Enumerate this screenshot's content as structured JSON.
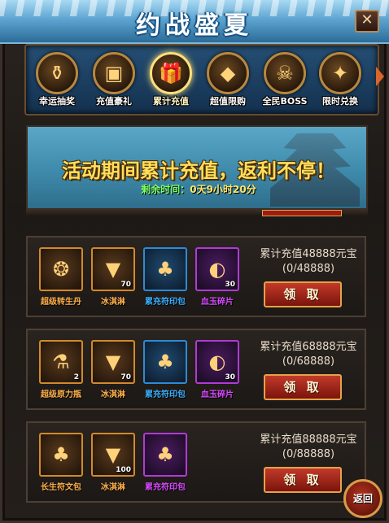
{
  "header": {
    "title": "约战盛夏",
    "close_glyph": "✕"
  },
  "tabs": [
    {
      "label": "幸运抽奖",
      "icon": "treasure-pot-icon",
      "glyph": "⚱",
      "active": false
    },
    {
      "label": "充值豪礼",
      "icon": "treasure-chest-icon",
      "glyph": "▣",
      "active": false
    },
    {
      "label": "累计充值",
      "icon": "gift-box-icon",
      "glyph": "🎁",
      "active": true
    },
    {
      "label": "超值限购",
      "icon": "gold-ingot-icon",
      "glyph": "◆",
      "active": false
    },
    {
      "label": "全民BOSS",
      "icon": "boss-head-icon",
      "glyph": "☠",
      "active": false
    },
    {
      "label": "限时兑换",
      "icon": "present-icon",
      "glyph": "✦",
      "active": false
    }
  ],
  "banner": {
    "headline": "活动期间累计充值，返利不停！",
    "remain_label": "剩余时间：",
    "remain_value": "0天9小时20分"
  },
  "rows": [
    {
      "goal": "累计充值48888元宝",
      "progress": "(0/48888)",
      "button": "领 取",
      "items": [
        {
          "name": "超级转生丹",
          "count": "",
          "rarity": "orange",
          "icon": "pill-icon",
          "glyph": "❂"
        },
        {
          "name": "冰淇淋",
          "count": "70",
          "rarity": "orange",
          "icon": "ice-cream-icon",
          "glyph": "▼"
        },
        {
          "name": "累充符印包",
          "count": "",
          "rarity": "blue",
          "icon": "pouch-icon",
          "glyph": "♣"
        },
        {
          "name": "血玉碎片",
          "count": "30",
          "rarity": "purple",
          "icon": "jade-shard-icon",
          "glyph": "◐"
        }
      ]
    },
    {
      "goal": "累计充值68888元宝",
      "progress": "(0/68888)",
      "button": "领 取",
      "items": [
        {
          "name": "超级原力瓶",
          "count": "2",
          "rarity": "orange",
          "icon": "potion-bottle-icon",
          "glyph": "⚗"
        },
        {
          "name": "冰淇淋",
          "count": "70",
          "rarity": "orange",
          "icon": "ice-cream-icon",
          "glyph": "▼"
        },
        {
          "name": "累充符印包",
          "count": "",
          "rarity": "blue",
          "icon": "pouch-icon",
          "glyph": "♣"
        },
        {
          "name": "血玉碎片",
          "count": "30",
          "rarity": "purple",
          "icon": "jade-shard-icon",
          "glyph": "◐"
        }
      ]
    },
    {
      "goal": "累计充值88888元宝",
      "progress": "(0/88888)",
      "button": "领 取",
      "items": [
        {
          "name": "长生符文包",
          "count": "",
          "rarity": "orange",
          "icon": "pouch-icon",
          "glyph": "♣"
        },
        {
          "name": "冰淇淋",
          "count": "100",
          "rarity": "orange",
          "icon": "ice-cream-icon",
          "glyph": "▼"
        },
        {
          "name": "累充符印包",
          "count": "",
          "rarity": "purple",
          "icon": "pouch-icon",
          "glyph": "♣"
        }
      ]
    }
  ],
  "back_button": "返回"
}
